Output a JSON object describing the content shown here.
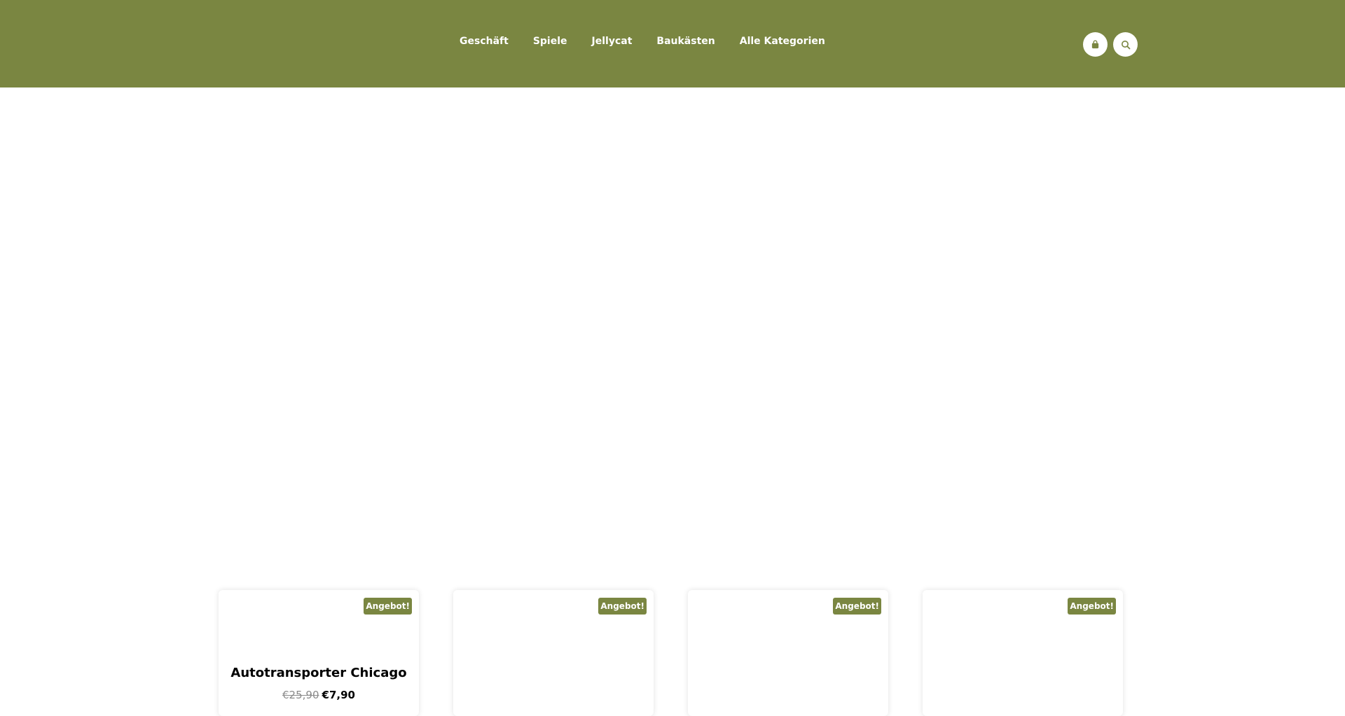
{
  "header": {
    "background_color": "#7a8641",
    "nav": [
      {
        "label": "Geschäft"
      },
      {
        "label": "Spiele"
      },
      {
        "label": "Jellycat"
      },
      {
        "label": "Baukästen"
      },
      {
        "label": "Alle Kategorien"
      }
    ],
    "icons": {
      "cart": "shopping-bag-icon",
      "search": "search-icon"
    }
  },
  "products": [
    {
      "badge": "Angebot!",
      "title": "Autotransporter Chicago",
      "price_old": "€25,90",
      "price_new": "€7,90"
    },
    {
      "badge": "Angebot!",
      "title": "",
      "price_old": "",
      "price_new": ""
    },
    {
      "badge": "Angebot!",
      "title": "",
      "price_old": "",
      "price_new": ""
    },
    {
      "badge": "Angebot!",
      "title": "",
      "price_old": "",
      "price_new": ""
    }
  ],
  "colors": {
    "accent": "#7a8641",
    "text": "#000000",
    "muted": "#8a8a8a"
  }
}
